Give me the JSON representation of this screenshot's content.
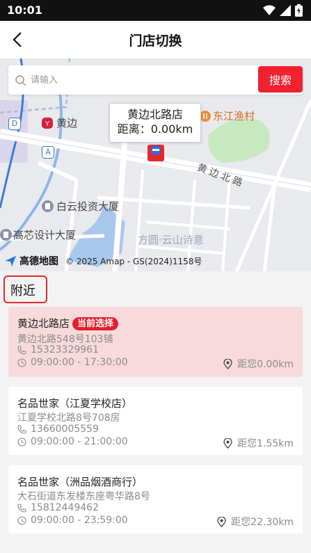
{
  "status_bar": {
    "time": "10:01"
  },
  "header": {
    "title": "门店切换"
  },
  "search": {
    "placeholder": "请输入",
    "button_label": "搜索"
  },
  "map": {
    "labels": {
      "huangbian": "黄边",
      "dongjiang_yucun": "东江渔村",
      "baiyun_touzi": "白云投资大厦",
      "gaoxin_sheji": "高芯设计大厦",
      "fangyuan": "方圆·云山诗意",
      "road": "黄边北路",
      "metro_d": "D",
      "metro_a": "A"
    },
    "bubble": {
      "name": "黄边北路店",
      "distance": "距离：0.00km"
    },
    "brand": "高德地图",
    "copyright": "© 2025 Amap - GS(2024)1158号"
  },
  "section": {
    "title": "附近"
  },
  "stores": [
    {
      "name": "黄边北路店",
      "badge": "当前选择",
      "address": "黄边北路548号103铺",
      "phone": "15323329961",
      "hours": "09:00:00 - 17:30:00",
      "distance": "距您0.00km"
    },
    {
      "name": "名品世家（江夏学校店）",
      "address": "江夏学校北路8号708房",
      "phone": "13660005559",
      "hours": "09:00:00 - 21:00:00",
      "distance": "距您1.55km"
    },
    {
      "name": "名品世家（洲品烟酒商行）",
      "address": "大石街道东发楼东座粤华路8号",
      "phone": "15812449462",
      "hours": "09:00:00 - 23:59:00",
      "distance": "距您22.30km"
    }
  ],
  "colors": {
    "accent": "#f2212f",
    "selected_card": "#f8dadd",
    "badge": "#e71d2c"
  }
}
